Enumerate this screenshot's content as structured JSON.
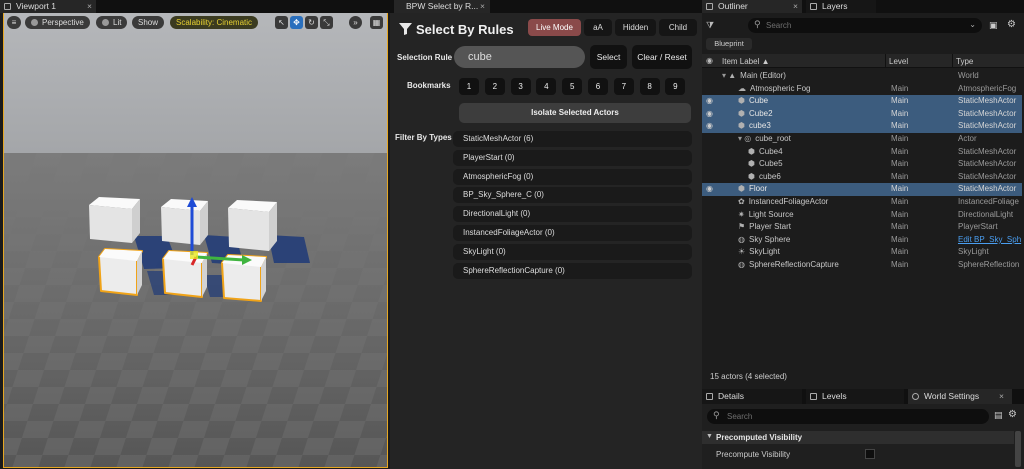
{
  "viewport": {
    "tab_title": "Viewport 1",
    "tab_close": "×",
    "menu_icon": "hamburger-icon",
    "perspective_label": "Perspective",
    "lit_label": "Lit",
    "show_label": "Show",
    "scalability_label": "Scalability: Cinematic",
    "tools": [
      "select-icon",
      "move-icon",
      "rotate-icon",
      "scale-icon"
    ],
    "more_label": "»"
  },
  "select_by_rules": {
    "tab_title": "BPW Select by R...",
    "tab_close": "×",
    "title": "Select By Rules",
    "live_mode_label": "Live Mode",
    "case_label": "aA",
    "hidden_label": "Hidden",
    "child_label": "Child",
    "selection_rule_label": "Selection Rule",
    "rule_value": "cube",
    "select_label": "Select",
    "clear_reset_label": "Clear / Reset",
    "bookmarks_label": "Bookmarks",
    "bookmarks": [
      "1",
      "2",
      "3",
      "4",
      "5",
      "6",
      "7",
      "8",
      "9"
    ],
    "isolate_label": "Isolate Selected Actors",
    "filter_label": "Filter By Types",
    "filter_types": [
      "StaticMeshActor  (6)",
      "PlayerStart  (0)",
      "AtmosphericFog  (0)",
      "BP_Sky_Sphere_C  (0)",
      "DirectionalLight  (0)",
      "InstancedFoliageActor  (0)",
      "SkyLight  (0)",
      "SphereReflectionCapture  (0)"
    ]
  },
  "outliner": {
    "tab_title": "Outliner",
    "tab_close": "×",
    "layers_tab": "Layers",
    "search_placeholder": "Search",
    "blueprint_label": "Blueprint",
    "col_item_label": "Item Label ▲",
    "col_level": "Level",
    "col_type": "Type",
    "rows": [
      {
        "name": "Main (Editor)",
        "level": "",
        "type": "World",
        "indent": 1,
        "sel": false,
        "eye": false,
        "icon": "world"
      },
      {
        "name": "Atmospheric Fog",
        "level": "Main",
        "type": "AtmosphericFog",
        "indent": 2,
        "sel": false,
        "eye": false,
        "icon": "fog"
      },
      {
        "name": "Cube",
        "level": "Main",
        "type": "StaticMeshActor",
        "indent": 2,
        "sel": true,
        "eye": true,
        "icon": "mesh"
      },
      {
        "name": "Cube2",
        "level": "Main",
        "type": "StaticMeshActor",
        "indent": 2,
        "sel": true,
        "eye": true,
        "icon": "mesh"
      },
      {
        "name": "cube3",
        "level": "Main",
        "type": "StaticMeshActor",
        "indent": 2,
        "sel": true,
        "eye": true,
        "icon": "mesh"
      },
      {
        "name": "cube_root",
        "level": "Main",
        "type": "Actor",
        "indent": 2,
        "sel": false,
        "eye": false,
        "icon": "actor"
      },
      {
        "name": "Cube4",
        "level": "Main",
        "type": "StaticMeshActor",
        "indent": 3,
        "sel": false,
        "eye": false,
        "icon": "mesh"
      },
      {
        "name": "Cube5",
        "level": "Main",
        "type": "StaticMeshActor",
        "indent": 3,
        "sel": false,
        "eye": false,
        "icon": "mesh"
      },
      {
        "name": "cube6",
        "level": "Main",
        "type": "StaticMeshActor",
        "indent": 3,
        "sel": false,
        "eye": false,
        "icon": "mesh"
      },
      {
        "name": "Floor",
        "level": "Main",
        "type": "StaticMeshActor",
        "indent": 2,
        "sel": true,
        "eye": true,
        "icon": "mesh"
      },
      {
        "name": "InstancedFoliageActor",
        "level": "Main",
        "type": "InstancedFoliage",
        "indent": 2,
        "sel": false,
        "eye": false,
        "icon": "foliage"
      },
      {
        "name": "Light Source",
        "level": "Main",
        "type": "DirectionalLight",
        "indent": 2,
        "sel": false,
        "eye": false,
        "icon": "light"
      },
      {
        "name": "Player Start",
        "level": "Main",
        "type": "PlayerStart",
        "indent": 2,
        "sel": false,
        "eye": false,
        "icon": "player"
      },
      {
        "name": "Sky Sphere",
        "level": "Main",
        "type": "Edit BP_Sky_Sph",
        "indent": 2,
        "sel": false,
        "eye": false,
        "icon": "sphere",
        "link": true
      },
      {
        "name": "SkyLight",
        "level": "Main",
        "type": "SkyLight",
        "indent": 2,
        "sel": false,
        "eye": false,
        "icon": "skylight"
      },
      {
        "name": "SphereReflectionCapture",
        "level": "Main",
        "type": "SphereReflection",
        "indent": 2,
        "sel": false,
        "eye": false,
        "icon": "sphere"
      }
    ],
    "status": "15 actors (4 selected)"
  },
  "details": {
    "details_tab": "Details",
    "levels_tab": "Levels",
    "world_settings_tab": "World Settings",
    "tab_close": "×",
    "search_placeholder": "Search",
    "section_title": "Precomputed Visibility",
    "property_label": "Precompute Visibility"
  },
  "colors": {
    "selection": "#3c5c7e",
    "live_mode": "#8a4a4a",
    "viewport_border": "#e6a722",
    "scalability_text": "#e8d232",
    "link": "#4a9ef0"
  }
}
